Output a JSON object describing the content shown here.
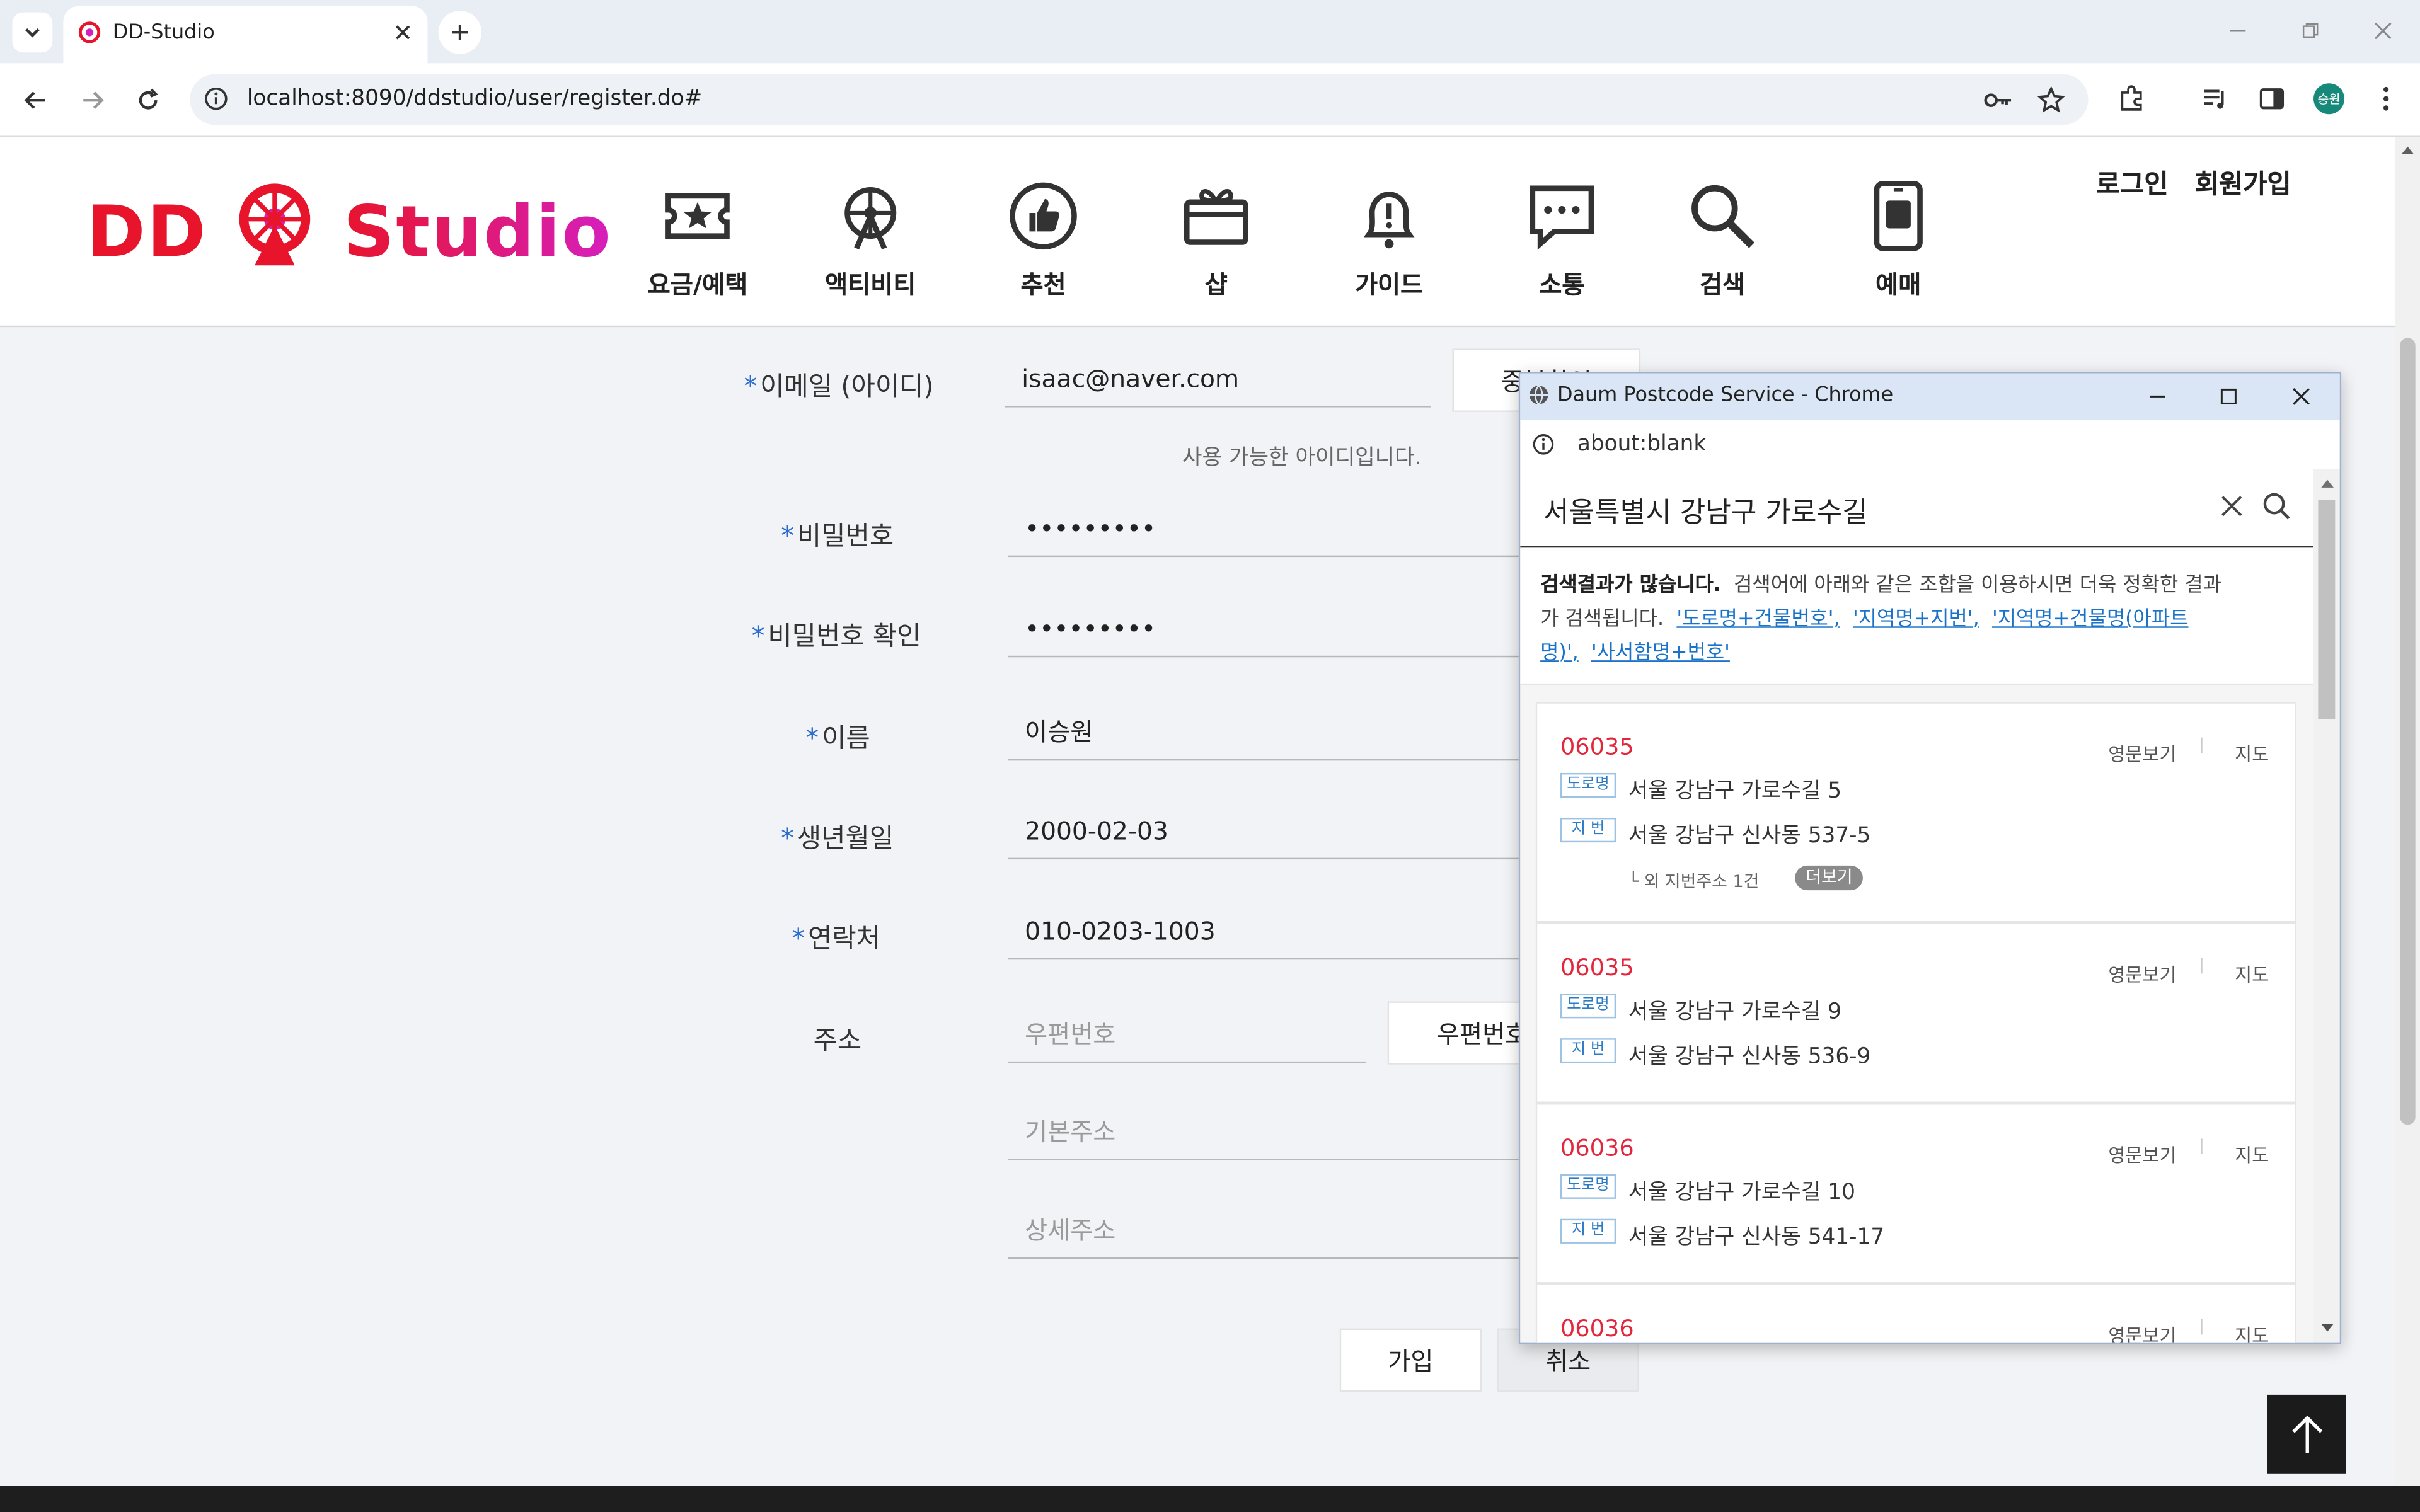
{
  "browser": {
    "tab_title": "DD-Studio",
    "url": "localhost:8090/ddstudio/user/register.do#",
    "profile_initials": "승원"
  },
  "header": {
    "logo_text": "DD Studio",
    "nav": [
      "요금/예택",
      "액티비티",
      "추천",
      "샵",
      "가이드",
      "소통",
      "검색",
      "예매"
    ],
    "login": "로그인",
    "signup": "회원가입"
  },
  "form": {
    "email_label": "이메일 (아이디)",
    "email_value": "isaac@naver.com",
    "dup_check_button": "중복확인",
    "email_status": "사용 가능한 아이디입니다.",
    "password_label": "비밀번호",
    "password_value": "•••••••••",
    "password_confirm_label": "비밀번호 확인",
    "password_confirm_value": "•••••••••",
    "name_label": "이름",
    "name_value": "이승원",
    "birth_label": "생년월일",
    "birth_value": "2000-02-03",
    "phone_label": "연락처",
    "phone_value": "010-0203-1003",
    "address_label": "주소",
    "zipcode_placeholder": "우편번호",
    "zipcode_button": "우편번호 찾기",
    "address_placeholder": "기본주소",
    "detail_placeholder": "상세주소",
    "submit_button": "가입",
    "cancel_button": "취소"
  },
  "popup": {
    "title": "Daum Postcode Service - Chrome",
    "url": "about:blank",
    "query": "서울특별시 강남구 가로수길",
    "notice_bold": "검색결과가 많습니다.",
    "notice_text1": "검색어에 아래와 같은 조합을 이용하시면 더욱 정확한 결과",
    "notice_text2": "가 검색됩니다.",
    "hint1": "'도로명+건물번호',",
    "hint2": "'지역명+지번',",
    "hint3a": "'지역명+건물명(아파트",
    "hint3b": "명)',",
    "hint4": "'사서함명+번호'",
    "tag_road": "도로명",
    "tag_jibun": "지 번",
    "english_link": "영문보기",
    "map_link": "지도",
    "more_jibun": "└ 외 지번주소 1건",
    "more_button": "더보기",
    "results": [
      {
        "zip": "06035",
        "road": "서울 강남구 가로수길 5",
        "jibun": "서울 강남구 신사동 537-5"
      },
      {
        "zip": "06035",
        "road": "서울 강남구 가로수길 9",
        "jibun": "서울 강남구 신사동 536-9"
      },
      {
        "zip": "06036",
        "road": "서울 강남구 가로수길 10",
        "jibun": "서울 강남구 신사동 541-17"
      },
      {
        "zip": "06036"
      }
    ]
  },
  "colors": {
    "logo_red": "#e8142c",
    "logo_magenta": "#d61fbd",
    "required_star": "#2a6dcc",
    "zip_red": "#e2263b",
    "link_blue": "#1a73c8"
  }
}
